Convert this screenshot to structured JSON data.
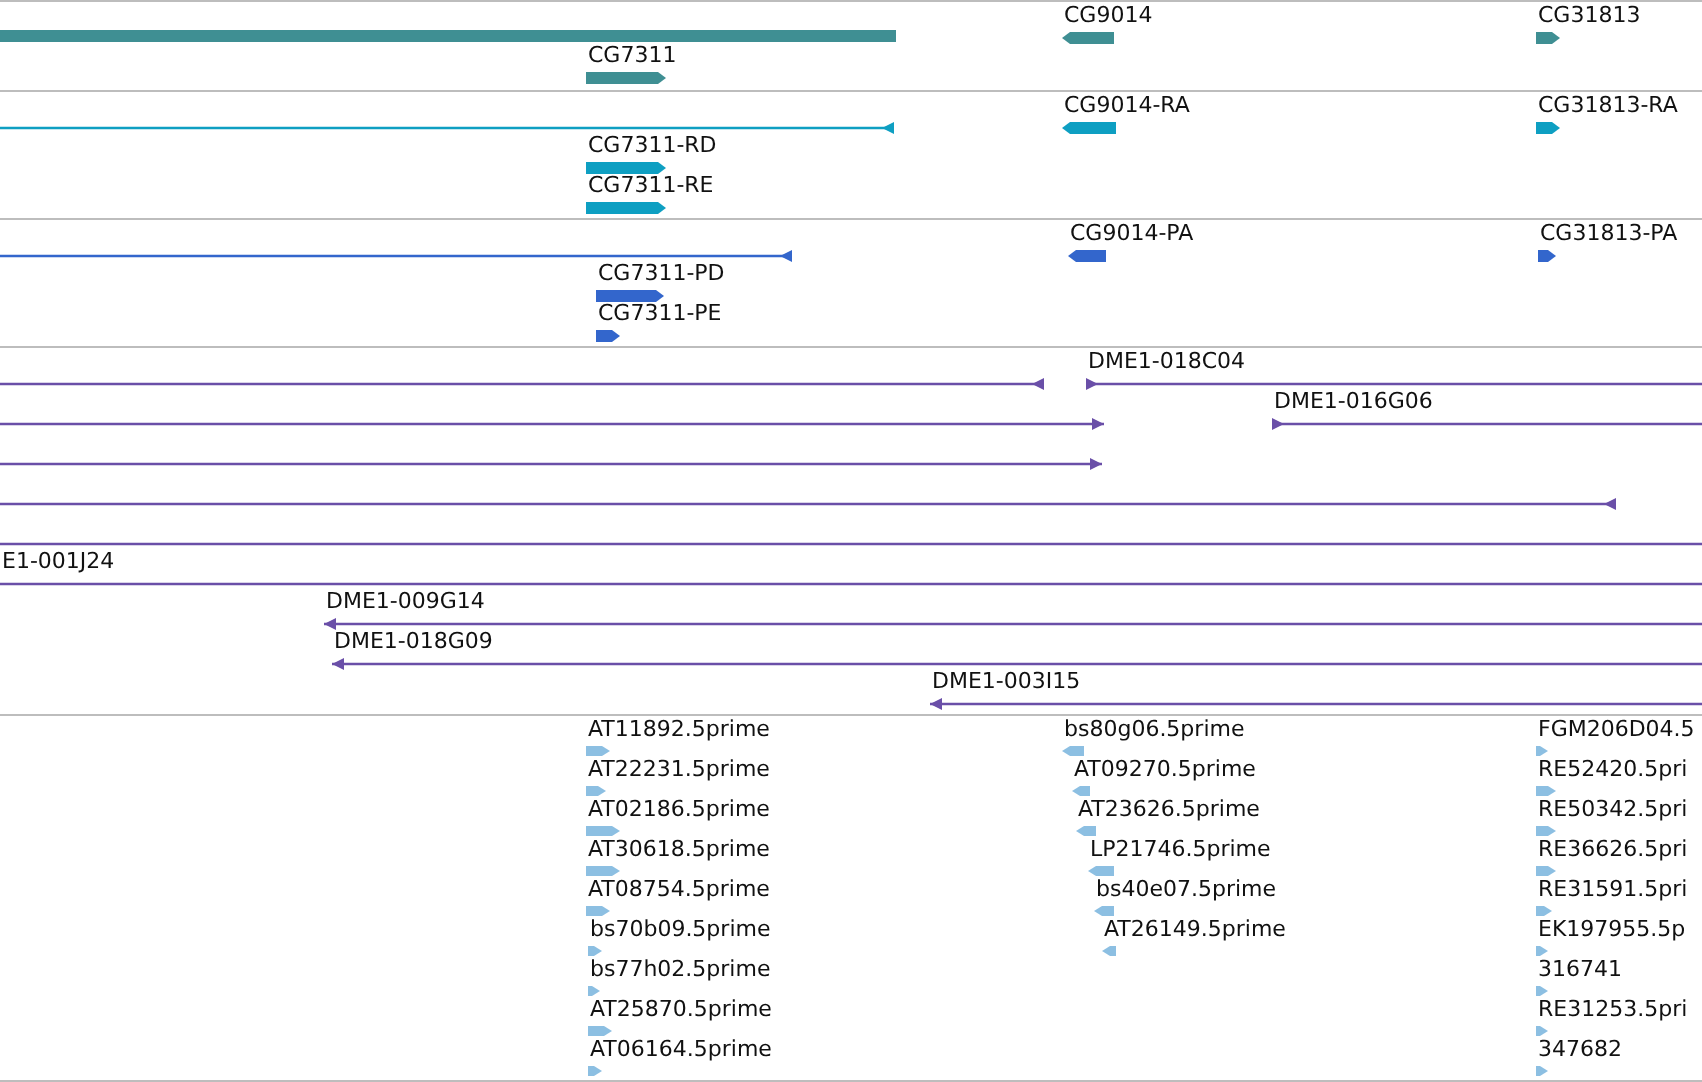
{
  "tracks": [
    {
      "kind": "genes",
      "features": [
        {
          "arrow": false
        },
        {
          "label": "CG7311",
          "reverse": false
        },
        {
          "label": "CG9014",
          "reverse": true
        },
        {
          "label": "CG31813",
          "reverse": false
        }
      ]
    },
    {
      "kind": "transcripts",
      "features": [
        {
          "reverse": true
        },
        {
          "label": "CG7311-RD",
          "reverse": false
        },
        {
          "label": "CG7311-RE",
          "reverse": false
        },
        {
          "label": "CG9014-RA",
          "reverse": true
        },
        {
          "label": "CG31813-RA",
          "reverse": false
        }
      ]
    },
    {
      "kind": "proteins",
      "features": [
        {
          "reverse": true
        },
        {
          "label": "CG7311-PD",
          "reverse": false
        },
        {
          "label": "CG7311-PE",
          "reverse": false
        },
        {
          "label": "CG9014-PA",
          "reverse": true
        },
        {
          "label": "CG31813-PA",
          "reverse": false
        }
      ]
    },
    {
      "kind": "clones",
      "features": [
        {
          "reverse": true
        },
        {
          "label": "DME1-018C04",
          "reverse": false
        },
        {
          "reverse": false
        },
        {
          "label": "DME1-016G06",
          "reverse": false
        },
        {
          "reverse": false
        },
        {
          "reverse": true
        },
        {
          "arrow": false
        },
        {
          "label": "E1-001J24",
          "arrow": false
        },
        {
          "label": "DME1-009G14",
          "reverse": true
        },
        {
          "label": "DME1-018G09",
          "reverse": true
        },
        {
          "label": "DME1-003I15",
          "reverse": true
        }
      ]
    },
    {
      "kind": "ests",
      "features": [
        {
          "label": "AT11892.5prime",
          "reverse": false
        },
        {
          "label": "AT22231.5prime",
          "reverse": false
        },
        {
          "label": "AT02186.5prime",
          "reverse": false
        },
        {
          "label": "AT30618.5prime",
          "reverse": false
        },
        {
          "label": "AT08754.5prime",
          "reverse": false
        },
        {
          "label": "bs70b09.5prime",
          "reverse": false
        },
        {
          "label": "bs77h02.5prime",
          "reverse": false
        },
        {
          "label": "AT25870.5prime",
          "reverse": false
        },
        {
          "label": "AT06164.5prime",
          "reverse": false
        },
        {
          "label": "bs80g06.5prime",
          "reverse": true
        },
        {
          "label": "AT09270.5prime",
          "reverse": true
        },
        {
          "label": "AT23626.5prime",
          "reverse": true
        },
        {
          "label": "LP21746.5prime",
          "reverse": true
        },
        {
          "label": "bs40e07.5prime",
          "reverse": true
        },
        {
          "label": "AT26149.5prime",
          "reverse": true
        },
        {
          "label": "FGM206D04.5",
          "reverse": false
        },
        {
          "label": "RE52420.5pri",
          "reverse": false
        },
        {
          "label": "RE50342.5pri",
          "reverse": false
        },
        {
          "label": "RE36626.5pri",
          "reverse": false
        },
        {
          "label": "RE31591.5pri",
          "reverse": false
        },
        {
          "label": "EK197955.5p",
          "reverse": false
        },
        {
          "label": "316741",
          "reverse": false
        },
        {
          "label": "RE31253.5pri",
          "reverse": false
        },
        {
          "label": "347682",
          "reverse": false
        }
      ]
    }
  ]
}
